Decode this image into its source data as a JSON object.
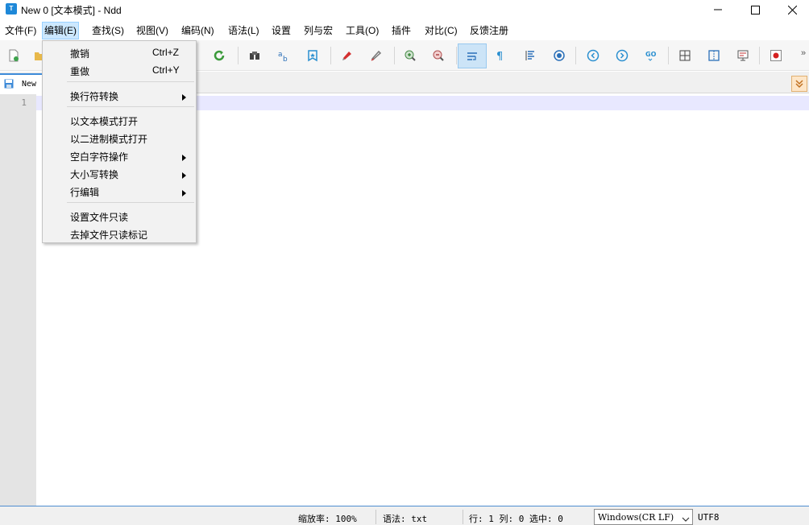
{
  "window": {
    "title": "New 0 [文本模式] - Ndd",
    "app_icon_letter": "T"
  },
  "menubar": {
    "items": [
      {
        "label": "文件(F)"
      },
      {
        "label": "编辑(E)"
      },
      {
        "label": "查找(S)"
      },
      {
        "label": "视图(V)"
      },
      {
        "label": "编码(N)"
      },
      {
        "label": "语法(L)"
      },
      {
        "label": "设置"
      },
      {
        "label": "列与宏"
      },
      {
        "label": "工具(O)"
      },
      {
        "label": "插件"
      },
      {
        "label": "对比(C)"
      },
      {
        "label": "反馈注册"
      }
    ],
    "active_index": 1
  },
  "edit_menu": {
    "undo": {
      "label": "撤销",
      "shortcut": "Ctrl+Z"
    },
    "redo": {
      "label": "重做",
      "shortcut": "Ctrl+Y"
    },
    "eol_convert": {
      "label": "换行符转换"
    },
    "open_text_mode": {
      "label": "以文本模式打开"
    },
    "open_binary_mode": {
      "label": "以二进制模式打开"
    },
    "whitespace_ops": {
      "label": "空白字符操作"
    },
    "case_convert": {
      "label": "大小写转换"
    },
    "line_edit": {
      "label": "行编辑"
    },
    "set_readonly": {
      "label": "设置文件只读"
    },
    "remove_readonly": {
      "label": "去掉文件只读标记"
    }
  },
  "tabs": [
    {
      "label": "New"
    }
  ],
  "editor": {
    "line_numbers": [
      "1"
    ]
  },
  "statusbar": {
    "zoom": "缩放率: 100%",
    "syntax": "语法: txt",
    "position": "行: 1 列: 0 选中: 0",
    "eol": "Windows(CR LF)",
    "encoding": "UTF8"
  },
  "colors": {
    "accent": "#1e88d8",
    "menu_highlight": "#cce8ff",
    "current_line": "#e8e8ff",
    "gutter": "#e4e4e4"
  }
}
